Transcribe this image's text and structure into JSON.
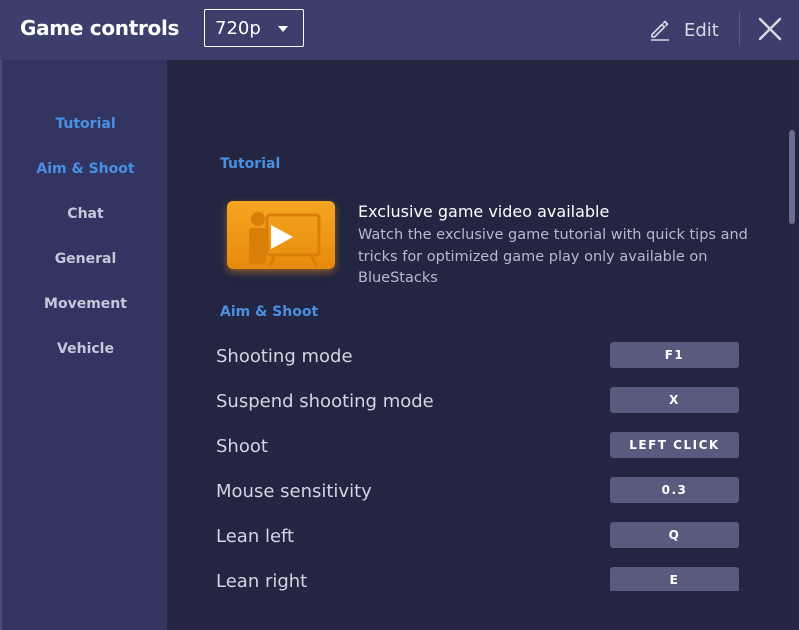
{
  "header": {
    "title": "Game controls",
    "resolution": "720p",
    "edit_label": "Edit"
  },
  "sidebar": {
    "items": [
      {
        "label": "Tutorial",
        "active": true
      },
      {
        "label": "Aim & Shoot",
        "active": true
      },
      {
        "label": "Chat",
        "active": false
      },
      {
        "label": "General",
        "active": false
      },
      {
        "label": "Movement",
        "active": false
      },
      {
        "label": "Vehicle",
        "active": false
      }
    ]
  },
  "main": {
    "tutorial_section": "Tutorial",
    "video": {
      "title": "Exclusive game video available",
      "description": "Watch the exclusive game tutorial with quick tips and tricks for optimized game play only available on BlueStacks"
    },
    "aim_section": "Aim & Shoot",
    "controls": [
      {
        "label": "Shooting mode",
        "key": "F1"
      },
      {
        "label": "Suspend shooting mode",
        "key": "X"
      },
      {
        "label": "Shoot",
        "key": "LEFT CLICK"
      },
      {
        "label": "Mouse sensitivity",
        "key": "0.3"
      },
      {
        "label": "Lean left",
        "key": "Q"
      },
      {
        "label": "Lean right",
        "key": "E"
      }
    ]
  },
  "icons": {
    "edit": "pencil-icon",
    "close": "close-icon",
    "dropdown": "chevron-down-icon",
    "video": "play-icon"
  },
  "colors": {
    "header_bg": "#3c3f6b",
    "sidebar_bg": "#323561",
    "content_bg": "#232542",
    "accent": "#4a90e2",
    "video_thumb": "#f5a623",
    "key_button": "#595b7e"
  }
}
